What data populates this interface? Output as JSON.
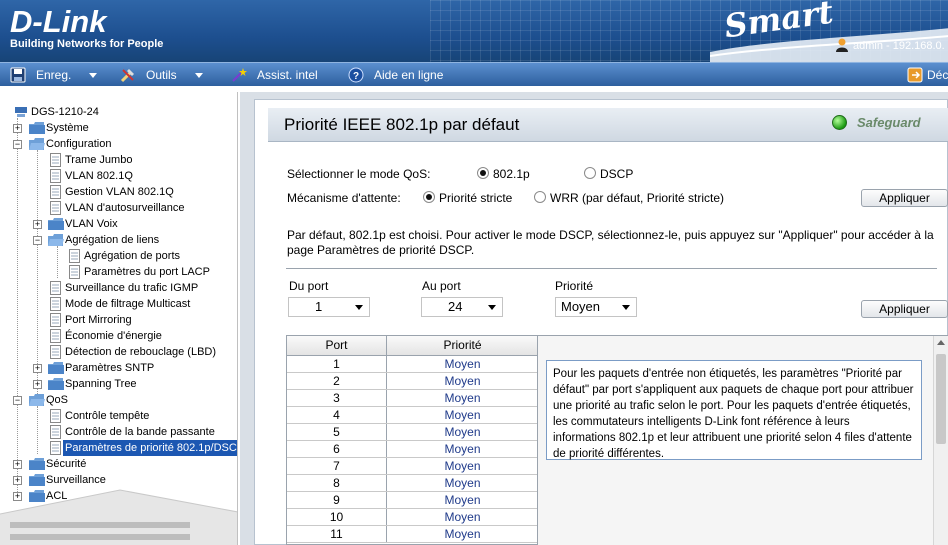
{
  "header": {
    "brand": "D-Link",
    "tagline": "Building Networks for People",
    "product": "Smart",
    "user": "admin - 192.168.0."
  },
  "toolbar": {
    "save": "Enreg.",
    "tools": "Outils",
    "wizard": "Assist. intel",
    "help": "Aide en ligne",
    "logout": "Déc"
  },
  "sidebar": {
    "device": "DGS-1210-24",
    "items": {
      "system": "Système",
      "configuration": "Configuration",
      "jumbo": "Trame Jumbo",
      "vlan": "VLAN 802.1Q",
      "vlan_mgmt": "Gestion VLAN 802.1Q",
      "auto_surv": "VLAN d'autosurveillance",
      "voice_vlan": "VLAN Voix",
      "link_agg": "Agrégation de liens",
      "port_agg": "Agrégation de ports",
      "lacp": "Paramètres du port LACP",
      "igmp": "Surveillance du trafic IGMP",
      "multicast": "Mode de filtrage Multicast",
      "mirroring": "Port Mirroring",
      "energy": "Économie d'énergie",
      "lbd": "Détection de rebouclage (LBD)",
      "sntp": "Paramètres SNTP",
      "stp": "Spanning Tree",
      "qos": "QoS",
      "storm": "Contrôle tempête",
      "bandwidth": "Contrôle de la bande passante",
      "priority": "Paramètres de priorité 802.1p/DSC",
      "security": "Sécurité",
      "monitoring": "Surveillance",
      "acl": "ACL"
    }
  },
  "main": {
    "title": "Priorité IEEE 802.1p par défaut",
    "safeguard": "Safeguard",
    "qos_mode_label": "Sélectionner le mode QoS:",
    "qos_opt1": "802.1p",
    "qos_opt2": "DSCP",
    "queue_label": "Mécanisme d'attente:",
    "queue_opt1": "Priorité stricte",
    "queue_opt2": "WRR (par défaut, Priorité stricte)",
    "apply": "Appliquer",
    "description": "Par défaut, 802.1p est choisi. Pour activer le mode DSCP, sélectionnez-le, puis appuyez sur \"Appliquer\" pour accéder à la page Paramètres de priorité DSCP.",
    "from_port_label": "Du port",
    "to_port_label": "Au port",
    "priority_label": "Priorité",
    "from_port_value": "1",
    "to_port_value": "24",
    "priority_value": "Moyen",
    "apply2": "Appliquer",
    "table": {
      "headers": [
        "Port",
        "Priorité"
      ],
      "rows": [
        [
          "1",
          "Moyen"
        ],
        [
          "2",
          "Moyen"
        ],
        [
          "3",
          "Moyen"
        ],
        [
          "4",
          "Moyen"
        ],
        [
          "5",
          "Moyen"
        ],
        [
          "6",
          "Moyen"
        ],
        [
          "7",
          "Moyen"
        ],
        [
          "8",
          "Moyen"
        ],
        [
          "9",
          "Moyen"
        ],
        [
          "10",
          "Moyen"
        ],
        [
          "11",
          "Moyen"
        ]
      ]
    },
    "info": "Pour les paquets d'entrée non étiquetés, les paramètres \"Priorité par défaut\" par port s'appliquent aux paquets de chaque port pour attribuer une priorité au trafic selon le port. Pour les paquets d'entrée étiquetés, les commutateurs intelligents D-Link font référence à leurs informations 802.1p et leur attribuent une priorité selon 4 files d'attente de priorité différentes."
  }
}
